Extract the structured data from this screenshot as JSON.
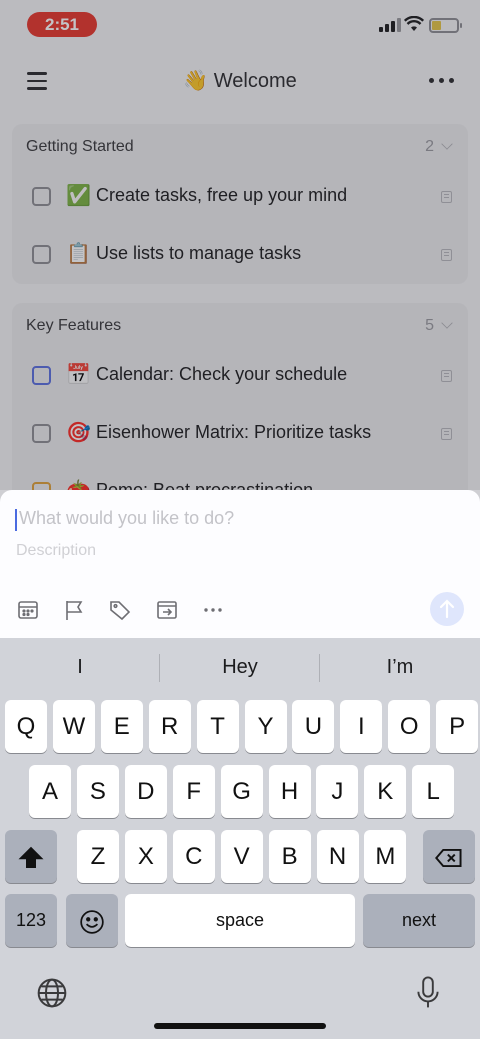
{
  "status_bar": {
    "time": "2:51",
    "time_color": "#e8372c"
  },
  "nav": {
    "title_emoji": "👋",
    "title": "Welcome"
  },
  "sections": [
    {
      "title": "Getting Started",
      "count": "2",
      "tasks": [
        {
          "emoji": "✅",
          "text": "Create tasks, free up your mind",
          "checkbox_color": "gray"
        },
        {
          "emoji": "📋",
          "text": "Use lists to manage tasks",
          "checkbox_color": "gray"
        }
      ]
    },
    {
      "title": "Key Features",
      "count": "5",
      "tasks": [
        {
          "emoji": "📅",
          "text": "Calendar: Check your schedule",
          "checkbox_color": "blue"
        },
        {
          "emoji": "🎯",
          "text": "Eisenhower Matrix: Prioritize tasks",
          "checkbox_color": "gray"
        },
        {
          "emoji": "🍅",
          "text": "Pomo: Beat procrastination",
          "checkbox_color": "orange"
        }
      ]
    }
  ],
  "composer": {
    "title_placeholder": "What would you like to do?",
    "description_placeholder": "Description",
    "tools": [
      "calendar-icon",
      "flag-icon",
      "tag-icon",
      "move-to-list-icon",
      "more-icon"
    ],
    "send_color": "#dfe6fc"
  },
  "keyboard": {
    "suggestions": [
      "I",
      "Hey",
      "I’m"
    ],
    "row1": [
      "Q",
      "W",
      "E",
      "R",
      "T",
      "Y",
      "U",
      "I",
      "O",
      "P"
    ],
    "row2": [
      "A",
      "S",
      "D",
      "F",
      "G",
      "H",
      "J",
      "K",
      "L"
    ],
    "row3": [
      "Z",
      "X",
      "C",
      "V",
      "B",
      "N",
      "M"
    ],
    "numbers_label": "123",
    "space_label": "space",
    "return_label": "next"
  }
}
